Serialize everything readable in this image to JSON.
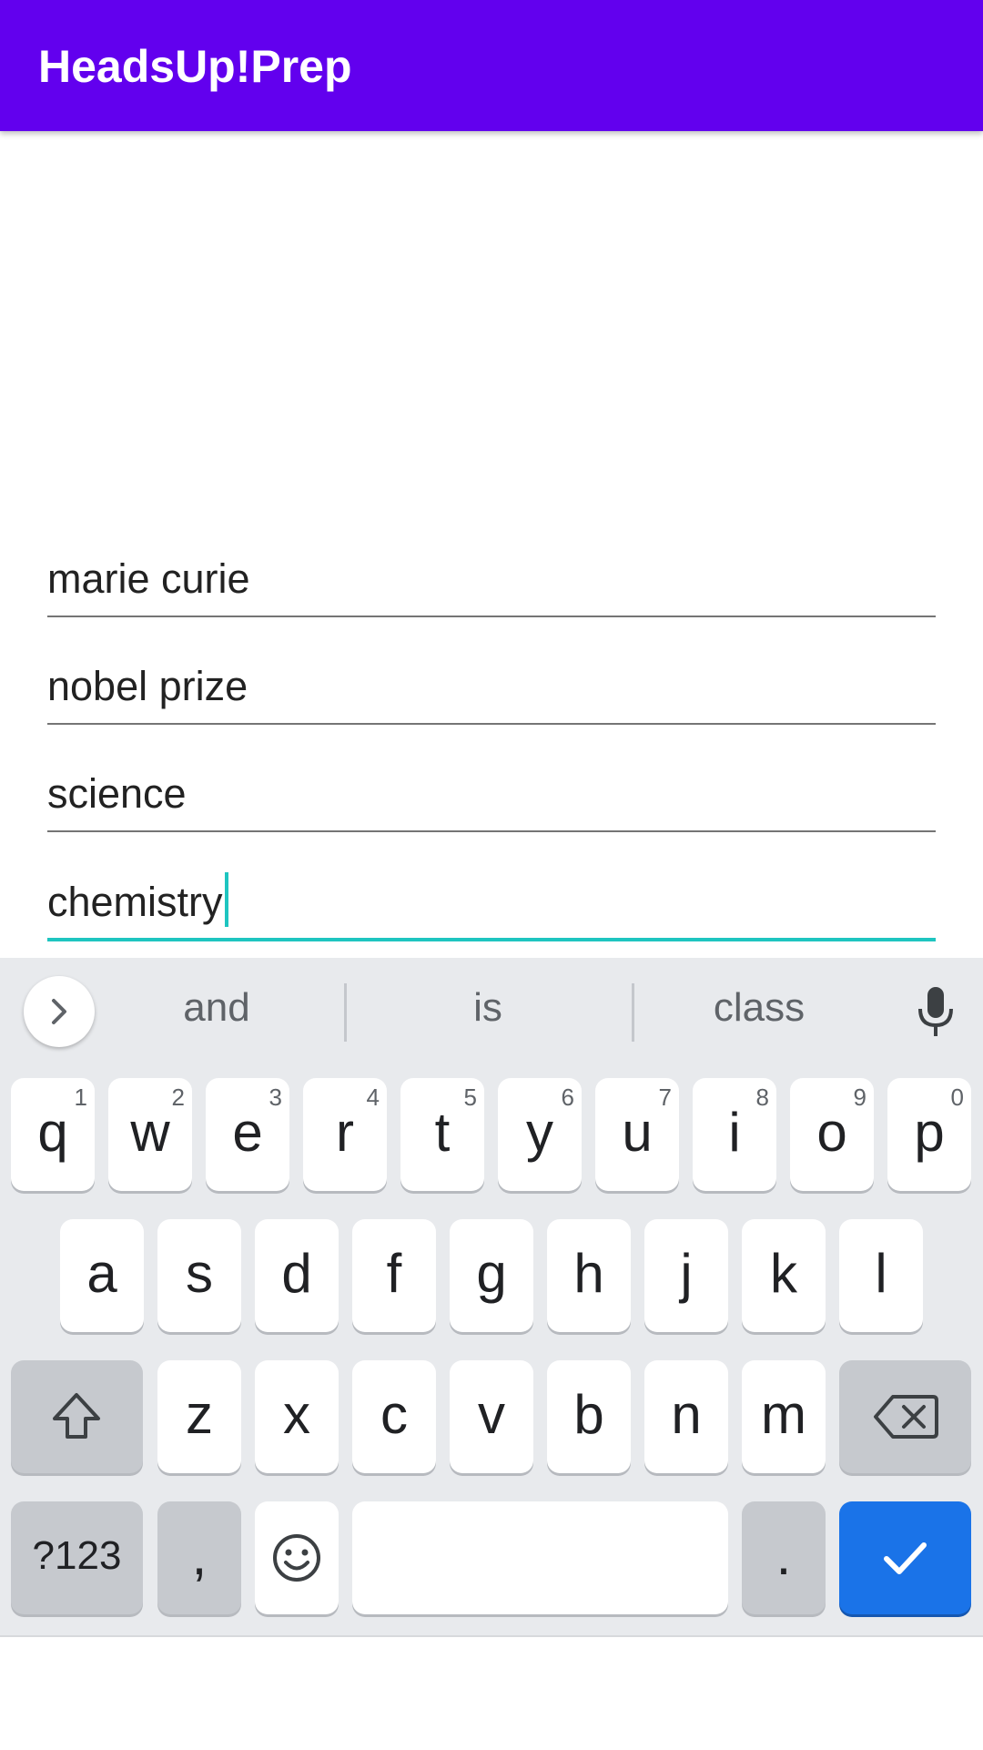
{
  "app": {
    "title": "HeadsUp!Prep"
  },
  "fields": [
    {
      "value": "marie curie"
    },
    {
      "value": "nobel prize"
    },
    {
      "value": "science"
    },
    {
      "value": "chemistry"
    }
  ],
  "keyboard": {
    "suggestions": [
      "and",
      "is",
      "class"
    ],
    "row1": [
      {
        "key": "q",
        "hint": "1"
      },
      {
        "key": "w",
        "hint": "2"
      },
      {
        "key": "e",
        "hint": "3"
      },
      {
        "key": "r",
        "hint": "4"
      },
      {
        "key": "t",
        "hint": "5"
      },
      {
        "key": "y",
        "hint": "6"
      },
      {
        "key": "u",
        "hint": "7"
      },
      {
        "key": "i",
        "hint": "8"
      },
      {
        "key": "o",
        "hint": "9"
      },
      {
        "key": "p",
        "hint": "0"
      }
    ],
    "row2": [
      "a",
      "s",
      "d",
      "f",
      "g",
      "h",
      "j",
      "k",
      "l"
    ],
    "row3": [
      "z",
      "x",
      "c",
      "v",
      "b",
      "n",
      "m"
    ],
    "symbols_label": "?123",
    "comma_label": ",",
    "period_label": ".",
    "icons": {
      "expand": "chevron-right-icon",
      "mic": "microphone-icon",
      "shift": "shift-icon",
      "backspace": "backspace-icon",
      "emoji": "emoji-icon",
      "enter": "check-icon"
    },
    "colors": {
      "enter": "#1a73e8",
      "accent": "#1ec5c0",
      "appbar": "#6200ee"
    }
  }
}
